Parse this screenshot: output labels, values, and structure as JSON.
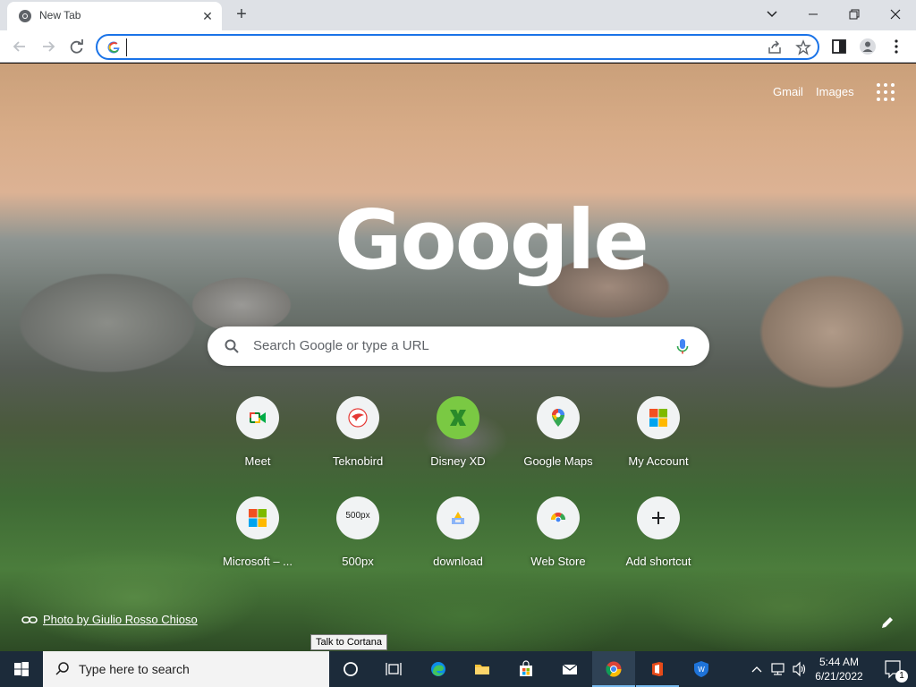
{
  "browser": {
    "tab": {
      "title": "New Tab",
      "close": "✕"
    },
    "new_tab": "+",
    "window_controls": {
      "list": "⌄",
      "minimize": "—",
      "restore": "❐",
      "close": "✕"
    }
  },
  "toolbar": {
    "address_value": "",
    "address_placeholder": ""
  },
  "page": {
    "links": {
      "gmail": "Gmail",
      "images": "Images"
    },
    "logo": "Google",
    "search": {
      "placeholder": "Search Google or type a URL"
    },
    "shortcuts": [
      {
        "label": "Meet",
        "icon": "meet-icon"
      },
      {
        "label": "Teknobird",
        "icon": "teknobird-icon"
      },
      {
        "label": "Disney XD",
        "icon": "disney-xd-icon"
      },
      {
        "label": "Google Maps",
        "icon": "maps-icon"
      },
      {
        "label": "My Account",
        "icon": "microsoft-icon"
      },
      {
        "label": "Microsoft – ...",
        "icon": "microsoft-icon"
      },
      {
        "label": "500px",
        "icon": "500px-icon"
      },
      {
        "label": "download",
        "icon": "download-site-icon"
      },
      {
        "label": "Web Store",
        "icon": "web-store-icon"
      },
      {
        "label": "Add shortcut",
        "icon": "plus-icon"
      }
    ],
    "badge_500px": "500px",
    "credit": "Photo by Giulio Rosso Chioso"
  },
  "tooltip": "Talk to Cortana",
  "taskbar": {
    "search_placeholder": "Type here to search",
    "time": "5:44 AM",
    "date": "6/21/2022",
    "notifications_count": "1"
  }
}
